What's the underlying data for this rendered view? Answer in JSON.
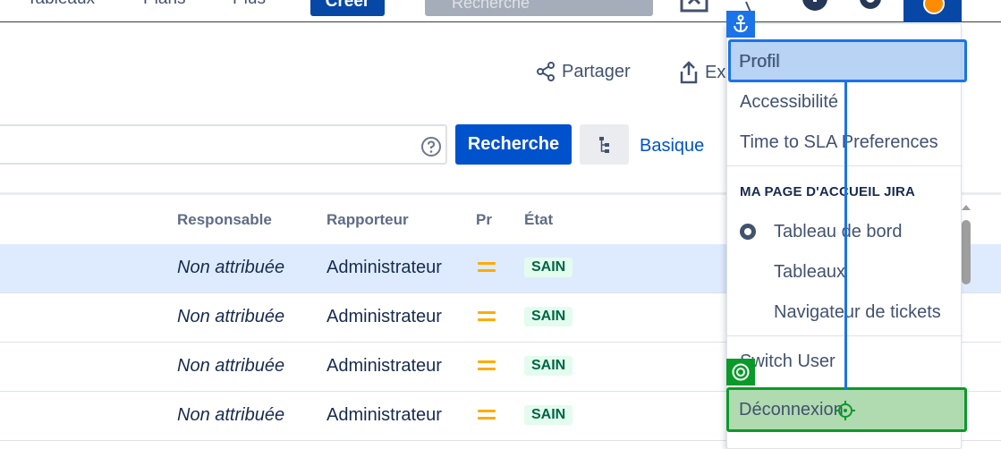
{
  "topnav": {
    "links": [
      "Tableaux",
      "Plans",
      "Plus"
    ],
    "create_label": "Créer",
    "search_placeholder": "Recherche"
  },
  "toolbar": {
    "share_label": "Partager",
    "export_label": "Exp",
    "search_button_label": "Recherche",
    "basic_link_label": "Basique"
  },
  "table": {
    "headers": {
      "assignee": "Responsable",
      "reporter": "Rapporteur",
      "priority": "Pr",
      "status": "État"
    },
    "rows": [
      {
        "assignee": "Non attribuée",
        "reporter": "Administrateur",
        "status": "SAIN",
        "selected": true
      },
      {
        "assignee": "Non attribuée",
        "reporter": "Administrateur",
        "status": "SAIN",
        "selected": false
      },
      {
        "assignee": "Non attribuée",
        "reporter": "Administrateur",
        "status": "SAIN",
        "selected": false
      },
      {
        "assignee": "Non attribuée",
        "reporter": "Administrateur",
        "status": "SAIN",
        "selected": false
      }
    ]
  },
  "user_menu": {
    "profile": "Profil",
    "accessibility": "Accessibilité",
    "sla_preferences": "Time to SLA Preferences",
    "homepage_heading": "MA PAGE D'ACCUEIL JIRA",
    "homepage_options": [
      "Tableau de bord",
      "Tableaux",
      "Navigateur de tickets"
    ],
    "switch_user": "Switch User",
    "logout": "Déconnexion"
  },
  "colors": {
    "primary": "#0052cc",
    "nav_dark": "#0747a6",
    "highlight_blue": "#1a73e8",
    "highlight_green": "#0a9a2a",
    "status_green_text": "#006644",
    "status_green_bg": "#e3fcef",
    "priority_medium": "#ffab00"
  }
}
